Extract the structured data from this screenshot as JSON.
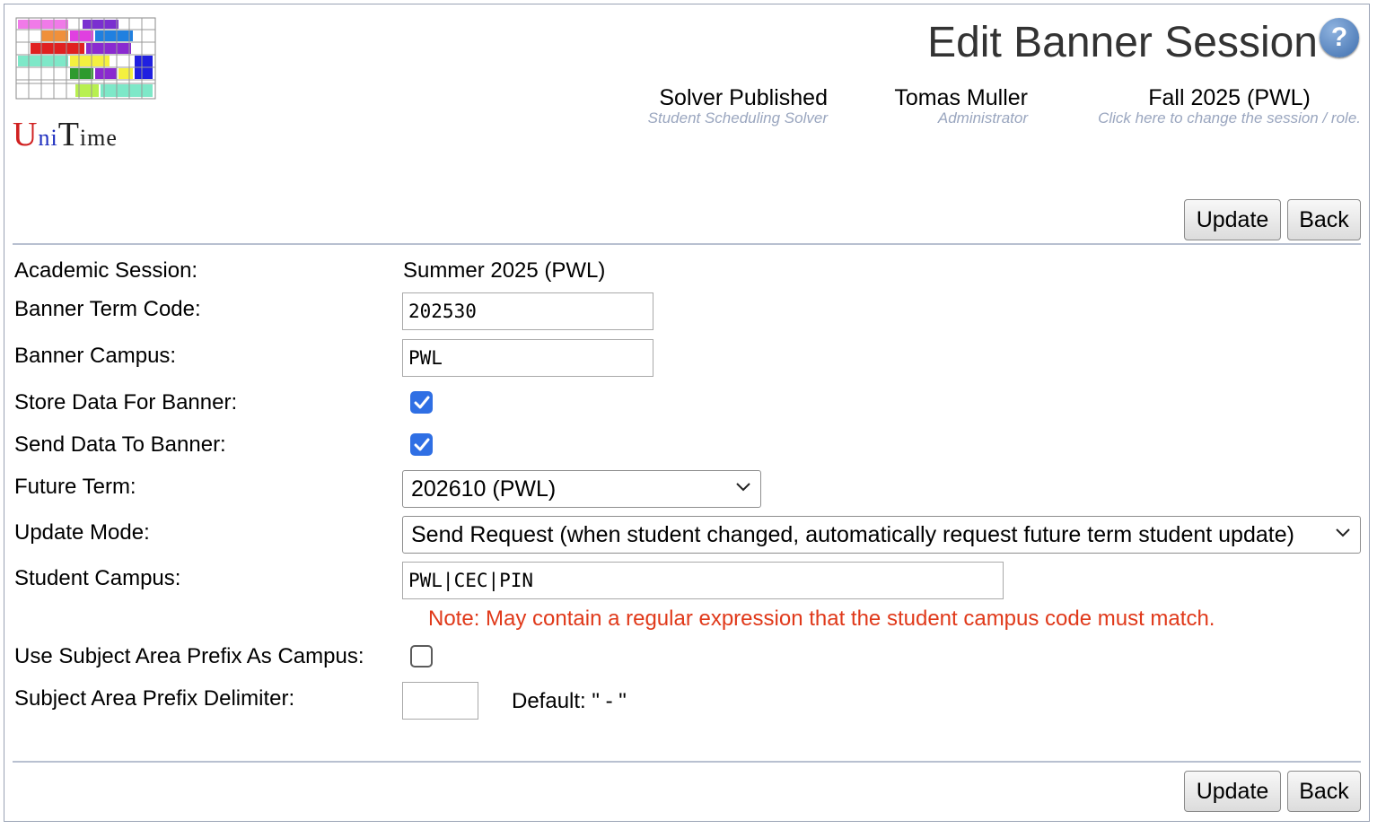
{
  "header": {
    "logo_text": "UniTime",
    "title": "Edit Banner Session",
    "help_icon": "help-icon",
    "solver": {
      "main": "Solver Published",
      "sub": "Student Scheduling Solver"
    },
    "user": {
      "main": "Tomas Muller",
      "sub": "Administrator"
    },
    "session": {
      "main": "Fall 2025 (PWL)",
      "sub": "Click here to change the session / role."
    }
  },
  "buttons": {
    "update": "Update",
    "back": "Back"
  },
  "form": {
    "academic_session": {
      "label": "Academic Session:",
      "value": "Summer 2025 (PWL)"
    },
    "banner_term_code": {
      "label": "Banner Term Code:",
      "value": "202530"
    },
    "banner_campus": {
      "label": "Banner Campus:",
      "value": "PWL"
    },
    "store_data": {
      "label": "Store Data For Banner:",
      "checked": true
    },
    "send_data": {
      "label": "Send Data To Banner:",
      "checked": true
    },
    "future_term": {
      "label": "Future Term:",
      "selected": "202610 (PWL)"
    },
    "update_mode": {
      "label": "Update Mode:",
      "selected": "Send Request (when student changed, automatically request future term student update)"
    },
    "student_campus": {
      "label": "Student Campus:",
      "value": "PWL|CEC|PIN",
      "note": "Note: May contain a regular expression that the student campus code must match."
    },
    "use_prefix": {
      "label": "Use Subject Area Prefix As Campus:",
      "checked": false
    },
    "prefix_delimiter": {
      "label": "Subject Area Prefix Delimiter:",
      "value": "",
      "default_note": "Default: \" - \""
    }
  },
  "colors": {
    "accent": "#2f6fe4",
    "note": "#e0391a",
    "separator": "#b8c0d0"
  }
}
